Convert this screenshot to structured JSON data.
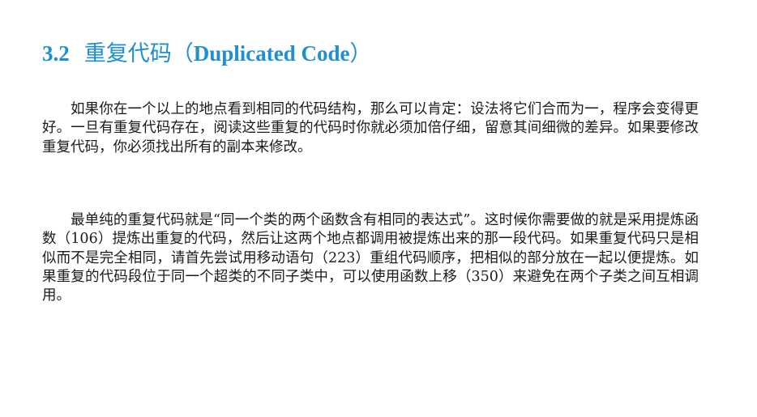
{
  "section": {
    "number": "3.2",
    "title_zh": "重复代码",
    "paren_open": "（",
    "title_en": "Duplicated Code",
    "paren_close": "）"
  },
  "paragraphs": [
    "如果你在一个以上的地点看到相同的代码结构，那么可以肯定：设法将它们合而为一，程序会变得更好。一旦有重复代码存在，阅读这些重复的代码时你就必须加倍仔细，留意其间细微的差异。如果要修改重复代码，你必须找出所有的副本来修改。",
    "最单纯的重复代码就是“同一个类的两个函数含有相同的表达式”。这时候你需要做的就是采用提炼函数（106）提炼出重复的代码，然后让这两个地点都调用被提炼出来的那一段代码。如果重复代码只是相似而不是完全相同，请首先尝试用移动语句（223）重组代码顺序，把相似的部分放在一起以便提炼。如果重复的代码段位于同一个超类的不同子类中，可以使用函数上移（350）来避免在两个子类之间互相调用。"
  ]
}
